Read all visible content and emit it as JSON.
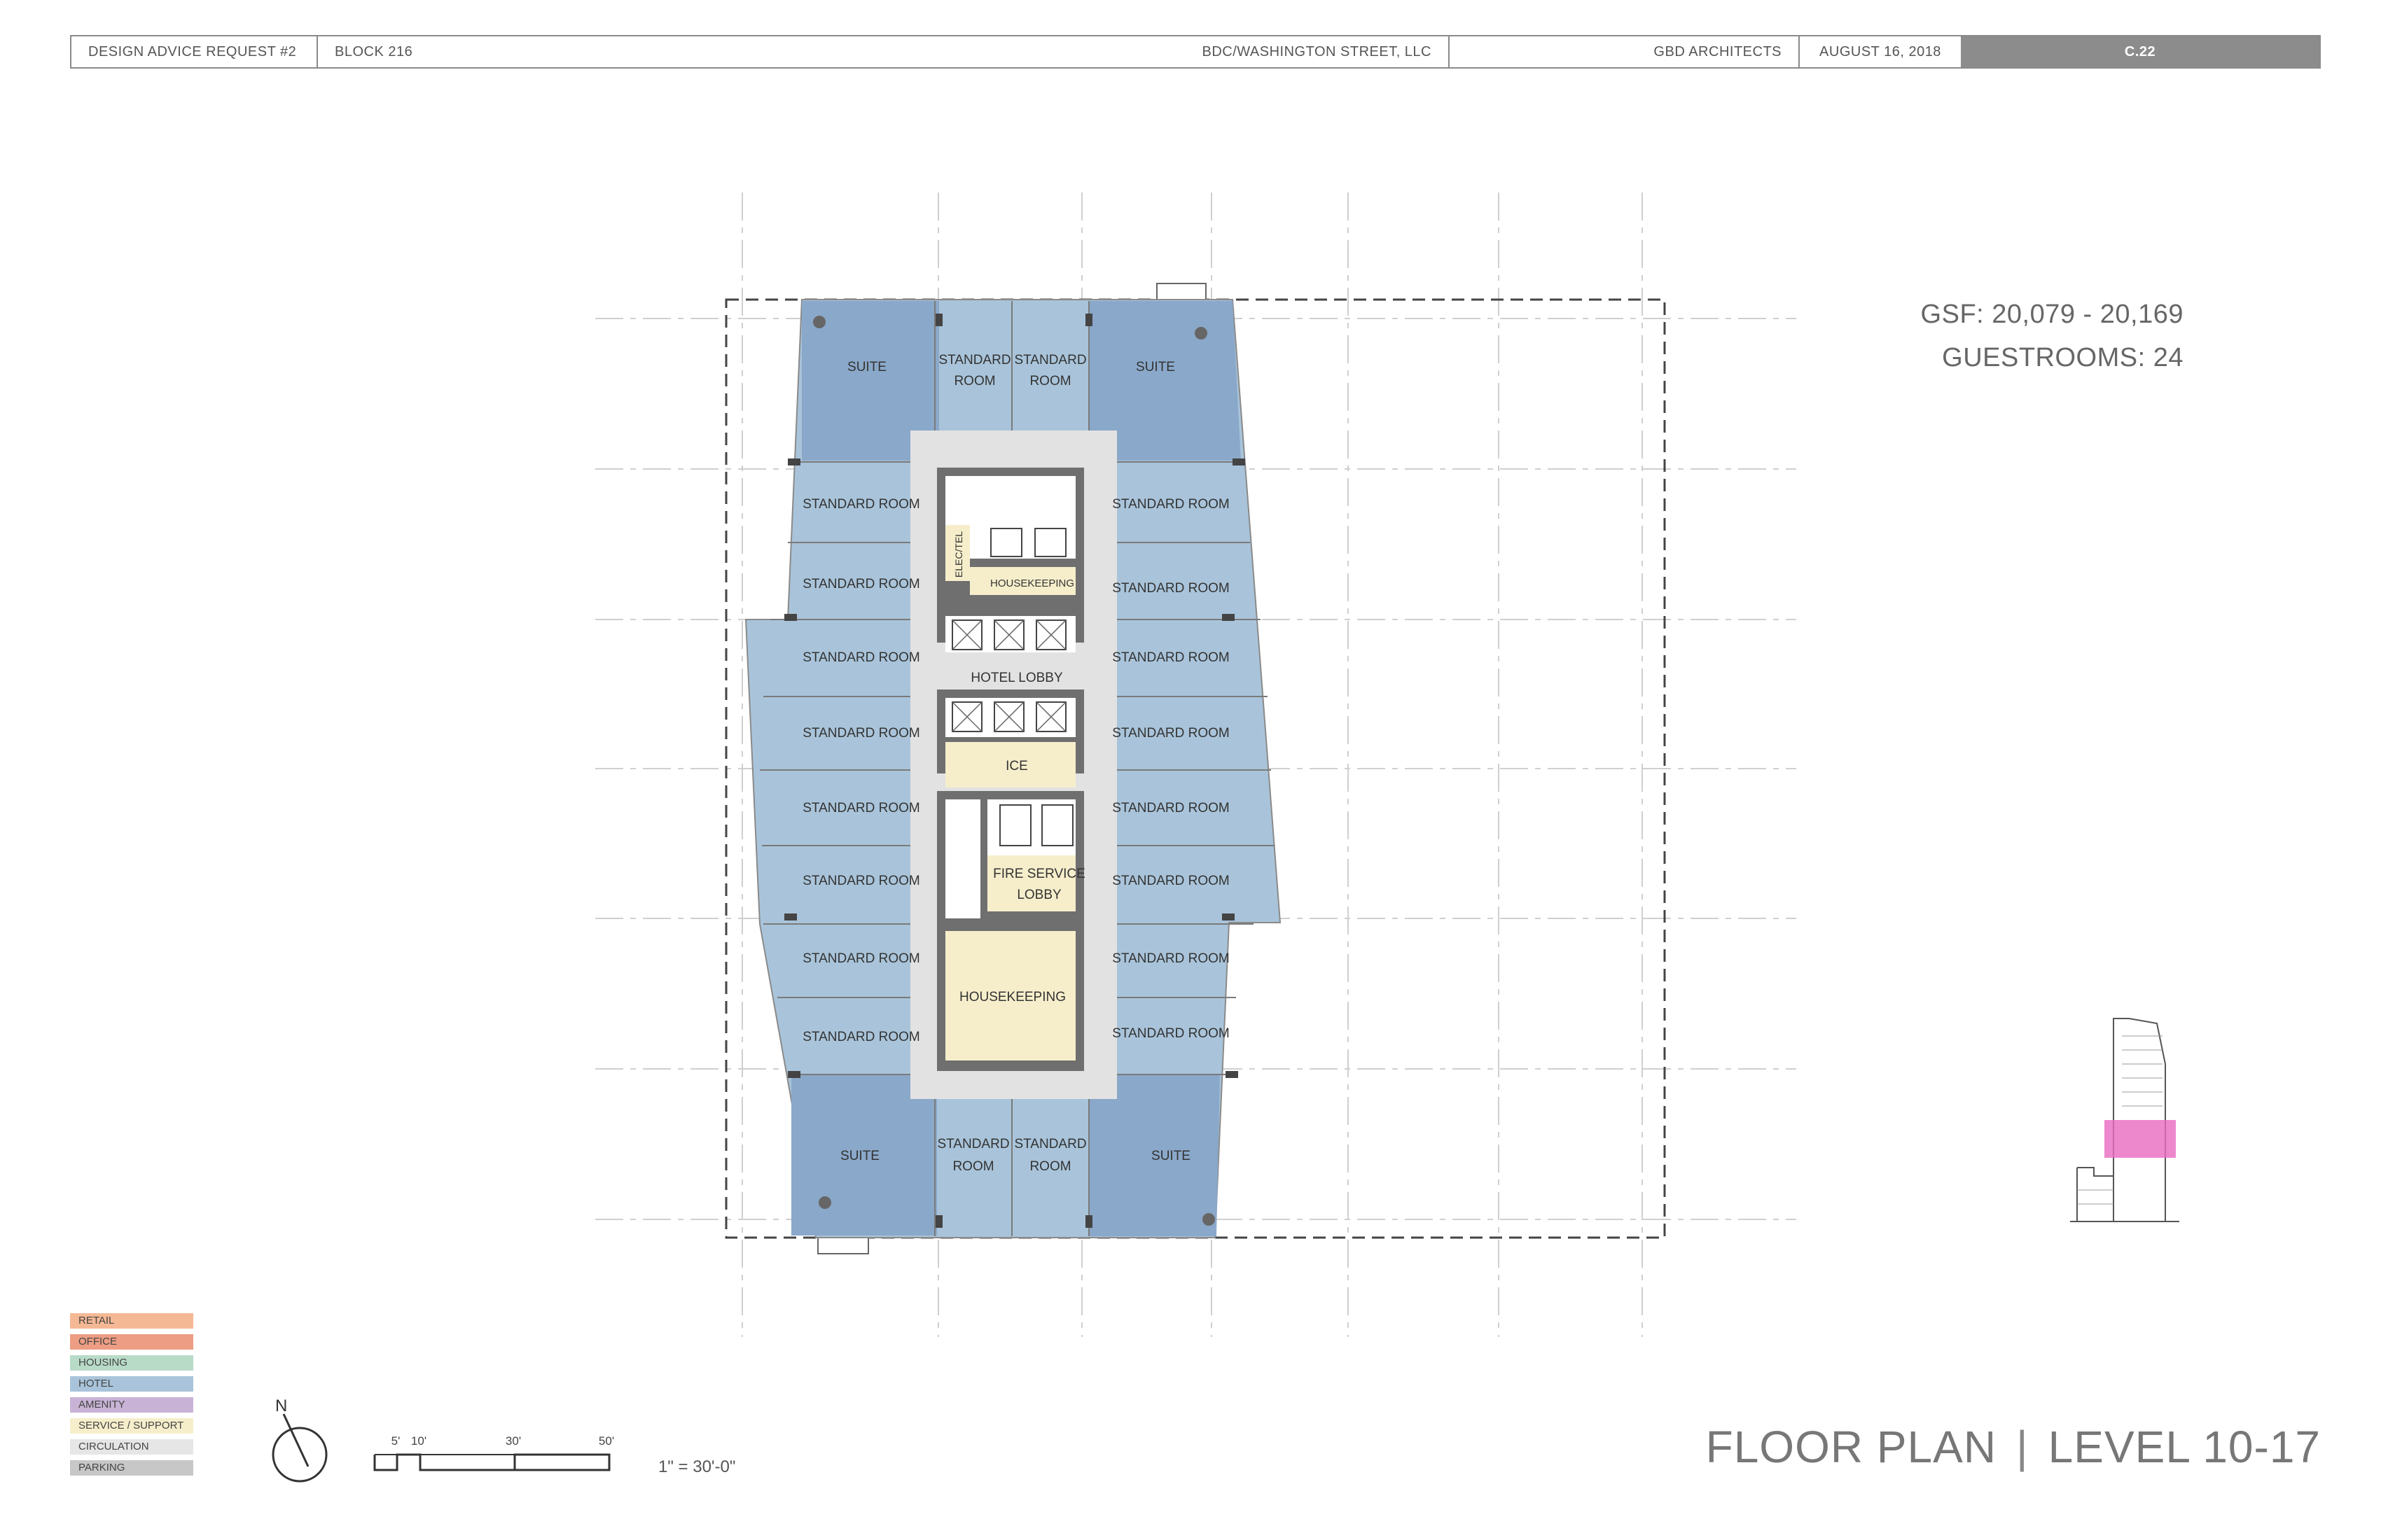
{
  "titlebar": {
    "submission": "DESIGN ADVICE REQUEST #2",
    "block": "BLOCK 216",
    "owner": "BDC/WASHINGTON STREET, LLC",
    "architect": "GBD ARCHITECTS",
    "date": "AUGUST 16,  2018",
    "sheet": "C.22"
  },
  "stats": {
    "gsf": "GSF:  20,079 - 20,169",
    "guestrooms": "GUESTROOMS:  24"
  },
  "plan": {
    "rooms": {
      "suite": "SUITE",
      "standard_room": "STANDARD ROOM",
      "standard_line1": "STANDARD",
      "standard_line2": "ROOM",
      "hotel_lobby": "HOTEL LOBBY",
      "ice": "ICE",
      "fire_service_lobby_line1": "FIRE SERVICE",
      "fire_service_lobby_line2": "LOBBY",
      "housekeeping_small": "HOUSEKEEPING",
      "housekeeping_large": "HOUSEKEEPING",
      "elec_tel": "ELEC/TEL"
    },
    "colors": {
      "hotel_room": "#a9c4da",
      "suite": "#8aa8c9",
      "service": "#f6eecb",
      "circulation": "#e2e2e2",
      "core_wall": "#6f6f6f"
    }
  },
  "legend": [
    {
      "label": "RETAIL",
      "color": "#f5b895"
    },
    {
      "label": "OFFICE",
      "color": "#ec9d83"
    },
    {
      "label": "HOUSING",
      "color": "#b8dbc8"
    },
    {
      "label": "HOTEL",
      "color": "#a9c4da"
    },
    {
      "label": "AMENITY",
      "color": "#c8b3d6"
    },
    {
      "label": "SERVICE / SUPPORT",
      "color": "#f6eecb"
    },
    {
      "label": "CIRCULATION",
      "color": "#e6e6e6"
    },
    {
      "label": "PARKING",
      "color": "#c7c7c7"
    }
  ],
  "north": "N",
  "scale": {
    "ticks": [
      "5'",
      "10'",
      "30'",
      "50'"
    ],
    "note": "1\" = 30'-0\""
  },
  "sheet_title": {
    "left": "FLOOR PLAN",
    "right": "LEVEL 10-17"
  }
}
